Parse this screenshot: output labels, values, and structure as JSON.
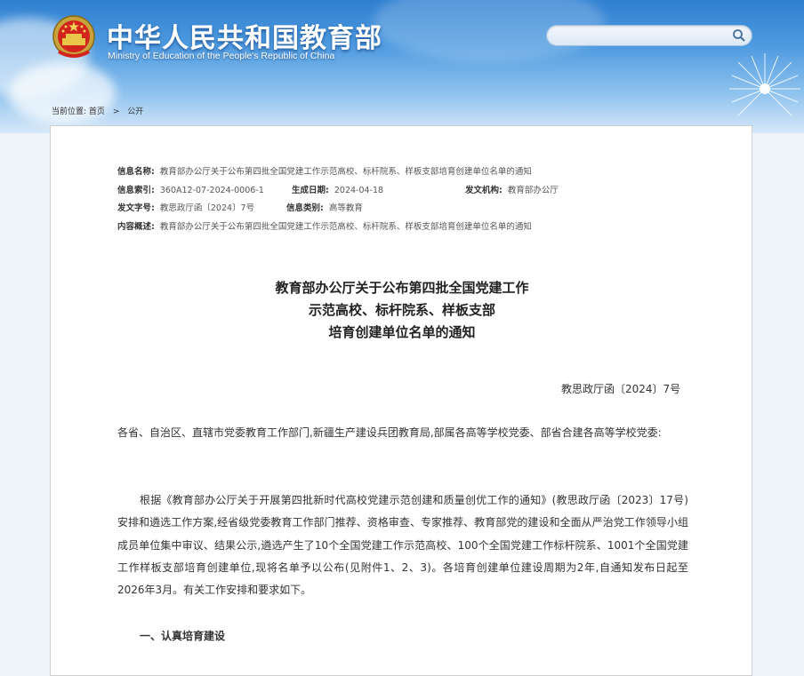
{
  "header": {
    "title": "中华人民共和国教育部",
    "subtitle": "Ministry of Education of the People's Republic of China",
    "emblem_icon": "national-emblem-icon",
    "colors": {
      "banner_top": "#2f7fd0",
      "banner_bottom": "#d7e9f8"
    }
  },
  "search": {
    "placeholder": "",
    "icon": "search-icon"
  },
  "breadcrumb": {
    "label": "当前位置:",
    "items": [
      "首页",
      "公开"
    ],
    "separator": ">"
  },
  "meta": {
    "name_label": "信息名称:",
    "name_value": "教育部办公厅关于公布第四批全国党建工作示范高校、标杆院系、样板支部培育创建单位名单的通知",
    "index_label": "信息索引:",
    "index_value": "360A12-07-2024-0006-1",
    "date_label": "生成日期:",
    "date_value": "2024-04-18",
    "issuer_label": "发文机构:",
    "issuer_value": "教育部办公厅",
    "docno_label": "发文字号:",
    "docno_value": "教思政厅函〔2024〕7号",
    "category_label": "信息类别:",
    "category_value": "高等教育",
    "summary_label": "内容概述:",
    "summary_value": "教育部办公厅关于公布第四批全国党建工作示范高校、标杆院系、样板支部培育创建单位名单的通知"
  },
  "document": {
    "title_lines": [
      "教育部办公厅关于公布第四批全国党建工作",
      "示范高校、标杆院系、样板支部",
      "培育创建单位名单的通知"
    ],
    "number": "教思政厅函〔2024〕7号",
    "recipients": "各省、自治区、直辖市党委教育工作部门,新疆生产建设兵团教育局,部属各高等学校党委、部省合建各高等学校党委:",
    "body": "根据《教育部办公厅关于开展第四批新时代高校党建示范创建和质量创优工作的通知》(教思政厅函〔2023〕17号)安排和遴选工作方案,经省级党委教育工作部门推荐、资格审查、专家推荐、教育部党的建设和全面从严治党工作领导小组成员单位集中审议、结果公示,遴选产生了10个全国党建工作示范高校、100个全国党建工作标杆院系、1001个全国党建工作样板支部培育创建单位,现将名单予以公布(见附件1、2、3)。各培育创建单位建设周期为2年,自通知发布日起至2026年3月。有关工作安排和要求如下。",
    "section1": "一、认真培育建设"
  }
}
